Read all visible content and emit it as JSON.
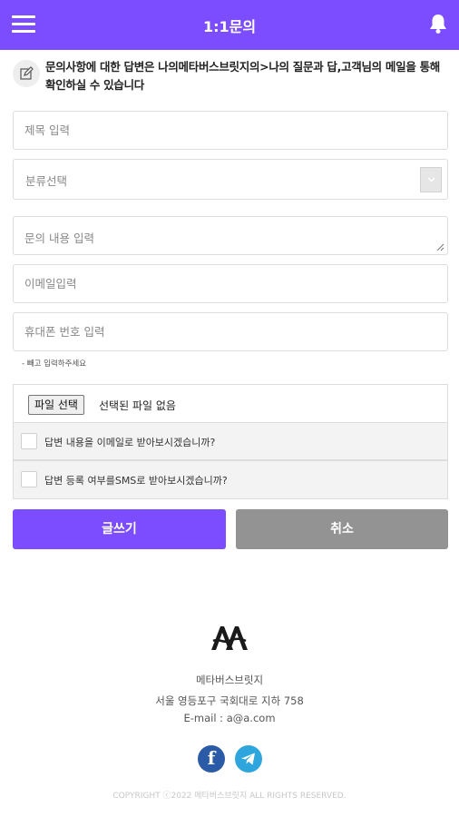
{
  "header": {
    "title": "1:1문의"
  },
  "notice": {
    "text": "문의사항에 대한 답변은 나의메타버스브릿지의>나의 질문과 답,고객님의 메일을 통해 확인하실 수 있습니다"
  },
  "form": {
    "title_placeholder": "제목 입력",
    "category_selected": "분류선택",
    "content_placeholder": "문의 내용 입력",
    "email_placeholder": "이메일입력",
    "phone_placeholder": "휴대폰 번호 입력",
    "phone_hint": "- 빼고 입력하주세요",
    "file_button": "파일 선택",
    "file_status": "선택된 파일 없음",
    "email_reply_label": "답변 내용을 이메일로 받아보시겠습니까?",
    "sms_reply_label": "답변 등록 여부를SMS로 받아보시겠습니까?",
    "email_reply_checked": false,
    "sms_reply_checked": false
  },
  "buttons": {
    "write": "글쓰기",
    "cancel": "취소"
  },
  "footer": {
    "company": "메타버스브릿지",
    "address": "서울 영등포구 국회대로 지하 758",
    "email": "E-mail : a@a.com",
    "facebook_icon": "f",
    "copyright": "COPYRIGHT ⓒ2022 메타버스브릿지 ALL RIGHTS RESERVED."
  },
  "colors": {
    "accent": "#7b4dff",
    "cancel": "#939393",
    "facebook": "#2b5aa6",
    "telegram": "#2ea6dd"
  }
}
